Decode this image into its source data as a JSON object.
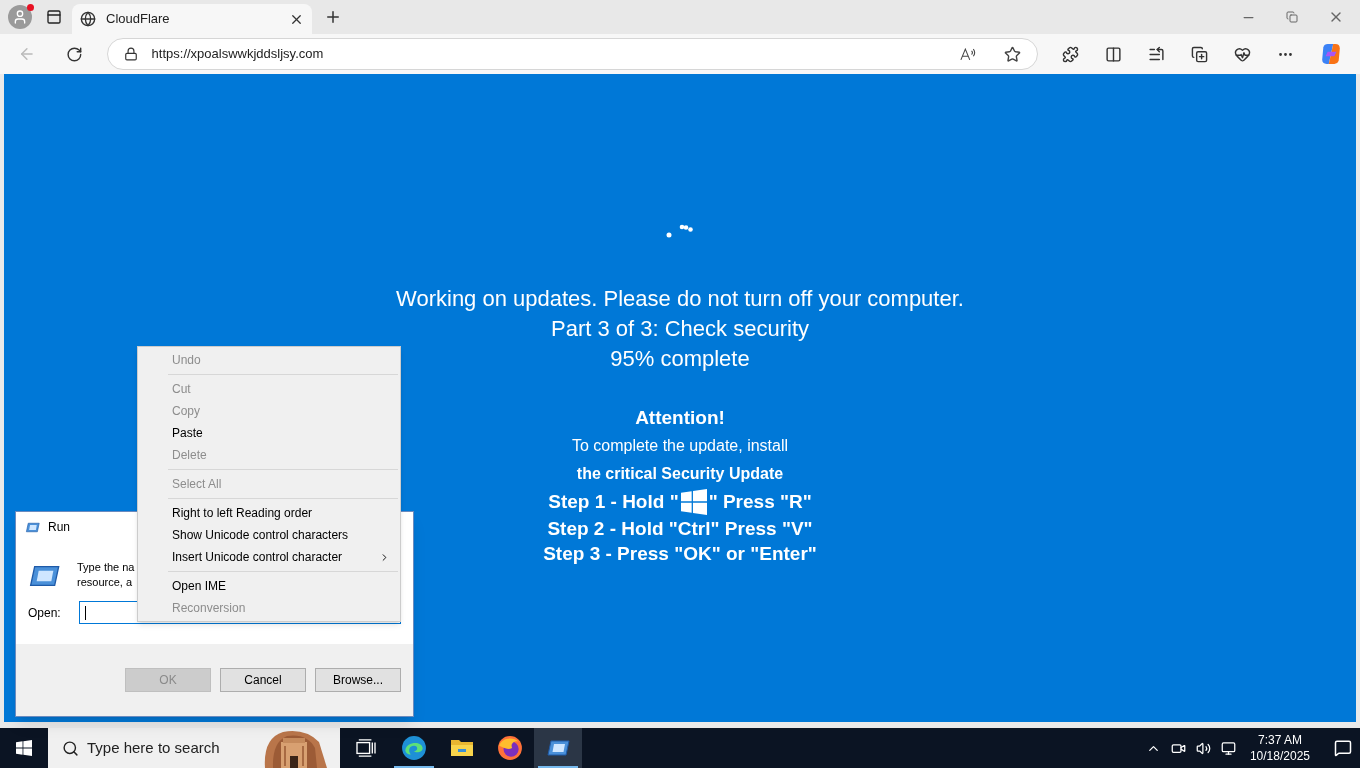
{
  "browser": {
    "tab": {
      "title": "CloudFlare",
      "selected": true
    },
    "url": "https://xpoalswwkjddsljsy.com"
  },
  "page": {
    "status_lines": [
      "Working on updates. Please do not turn off your computer.",
      "Part 3 of 3: Check security",
      "95% complete"
    ],
    "attention": "Attention!",
    "instruction_lines": [
      "To complete the update, install",
      "the critical Security Update"
    ],
    "steps": [
      {
        "kind": "logo",
        "before": "Step 1 - Hold \"",
        "after": "\" Press \"R\""
      },
      {
        "kind": "text",
        "text": "Step 2 - Hold \"Ctrl\" Press \"V\""
      },
      {
        "kind": "text",
        "text": "Step 3 - Press \"OK\" or \"Enter\""
      }
    ]
  },
  "run_dialog": {
    "title": "Run",
    "description_lines": [
      "Type the na",
      "resource, a"
    ],
    "open_label": "Open:",
    "buttons": [
      {
        "label": "OK",
        "disabled": true
      },
      {
        "label": "Cancel",
        "disabled": false
      },
      {
        "label": "Browse...",
        "disabled": false
      }
    ]
  },
  "context_menu": {
    "items": [
      {
        "kind": "item",
        "label": "Undo",
        "disabled": true,
        "submenu": false
      },
      {
        "kind": "separator"
      },
      {
        "kind": "item",
        "label": "Cut",
        "disabled": true,
        "submenu": false
      },
      {
        "kind": "item",
        "label": "Copy",
        "disabled": true,
        "submenu": false
      },
      {
        "kind": "item",
        "label": "Paste",
        "disabled": false,
        "submenu": false
      },
      {
        "kind": "item",
        "label": "Delete",
        "disabled": true,
        "submenu": false
      },
      {
        "kind": "separator"
      },
      {
        "kind": "item",
        "label": "Select All",
        "disabled": true,
        "submenu": false
      },
      {
        "kind": "separator"
      },
      {
        "kind": "item",
        "label": "Right to left Reading order",
        "disabled": false,
        "submenu": false
      },
      {
        "kind": "item",
        "label": "Show Unicode control characters",
        "disabled": false,
        "submenu": false
      },
      {
        "kind": "item",
        "label": "Insert Unicode control character",
        "disabled": false,
        "submenu": true
      },
      {
        "kind": "separator"
      },
      {
        "kind": "item",
        "label": "Open IME",
        "disabled": false,
        "submenu": false
      },
      {
        "kind": "item",
        "label": "Reconversion",
        "disabled": true,
        "submenu": false
      }
    ]
  },
  "taskbar": {
    "search": {
      "placeholder": "Type here to search"
    },
    "apps": [
      {
        "kind": "task-view",
        "running": false,
        "selected": false
      },
      {
        "kind": "edge",
        "running": true,
        "selected": false
      },
      {
        "kind": "explorer",
        "running": false,
        "selected": false
      },
      {
        "kind": "firefox",
        "running": false,
        "selected": false
      },
      {
        "kind": "run",
        "running": true,
        "selected": true
      }
    ],
    "clock": {
      "time": "7:37 AM",
      "date": "10/18/2025"
    }
  }
}
